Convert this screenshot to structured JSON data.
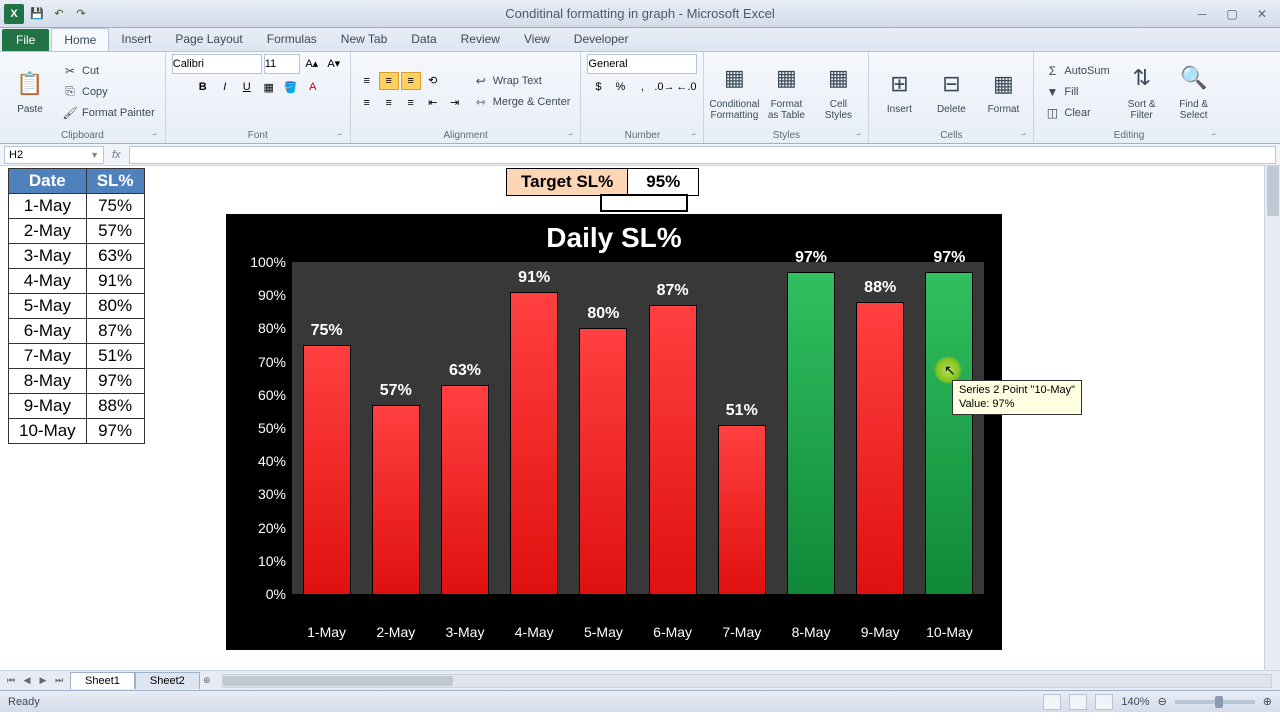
{
  "app": {
    "title": "Conditinal formatting in graph - Microsoft Excel",
    "ready": "Ready",
    "zoom": "140%"
  },
  "tabs": {
    "file": "File",
    "list": [
      "Home",
      "Insert",
      "Page Layout",
      "Formulas",
      "New Tab",
      "Data",
      "Review",
      "View",
      "Developer"
    ],
    "active": 0
  },
  "ribbon": {
    "clipboard": {
      "label": "Clipboard",
      "paste": "Paste",
      "cut": "Cut",
      "copy": "Copy",
      "painter": "Format Painter"
    },
    "font": {
      "label": "Font",
      "name": "Calibri",
      "size": "11"
    },
    "alignment": {
      "label": "Alignment",
      "wrap": "Wrap Text",
      "merge": "Merge & Center"
    },
    "number": {
      "label": "Number",
      "format": "General"
    },
    "styles": {
      "label": "Styles",
      "cond": "Conditional Formatting",
      "table": "Format as Table",
      "cell": "Cell Styles"
    },
    "cells": {
      "label": "Cells",
      "insert": "Insert",
      "delete": "Delete",
      "format": "Format"
    },
    "editing": {
      "label": "Editing",
      "autosum": "AutoSum",
      "fill": "Fill",
      "clear": "Clear",
      "sort": "Sort & Filter",
      "find": "Find & Select"
    }
  },
  "namebox": "H2",
  "table": {
    "headers": [
      "Date",
      "SL%"
    ],
    "rows": [
      [
        "1-May",
        "75%"
      ],
      [
        "2-May",
        "57%"
      ],
      [
        "3-May",
        "63%"
      ],
      [
        "4-May",
        "91%"
      ],
      [
        "5-May",
        "80%"
      ],
      [
        "6-May",
        "87%"
      ],
      [
        "7-May",
        "51%"
      ],
      [
        "8-May",
        "97%"
      ],
      [
        "9-May",
        "88%"
      ],
      [
        "10-May",
        "97%"
      ]
    ]
  },
  "target": {
    "label": "Target SL%",
    "value": "95%"
  },
  "chart_data": {
    "type": "bar",
    "title": "Daily SL%",
    "categories": [
      "1-May",
      "2-May",
      "3-May",
      "4-May",
      "5-May",
      "6-May",
      "7-May",
      "8-May",
      "9-May",
      "10-May"
    ],
    "values": [
      75,
      57,
      63,
      91,
      80,
      87,
      51,
      97,
      88,
      97
    ],
    "threshold": 95,
    "ylim": [
      0,
      100
    ],
    "yticks": [
      "0%",
      "10%",
      "20%",
      "30%",
      "40%",
      "50%",
      "60%",
      "70%",
      "80%",
      "90%",
      "100%"
    ],
    "ylabel": "",
    "xlabel": ""
  },
  "tooltip": {
    "line1": "Series 2 Point \"10-May\"",
    "line2": "Value: 97%"
  },
  "sheets": [
    "Sheet1",
    "Sheet2"
  ]
}
